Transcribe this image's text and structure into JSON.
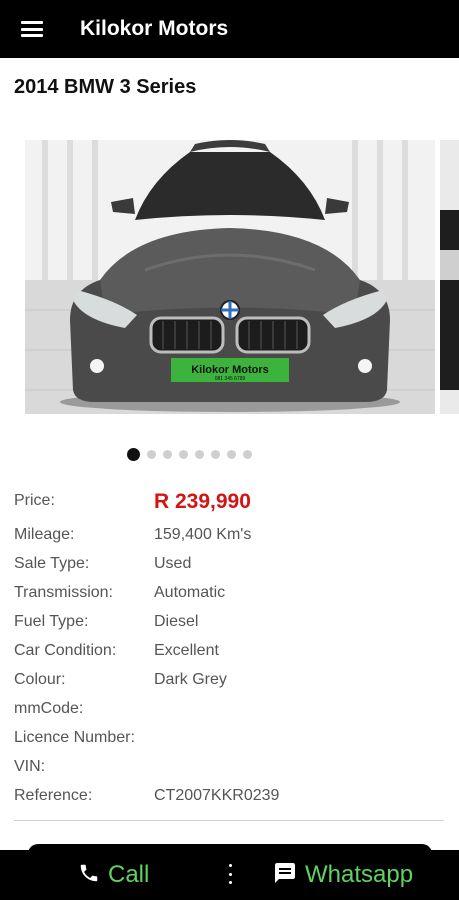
{
  "app": {
    "title": "Kilokor Motors",
    "menu_icon": "hamburger-menu-icon"
  },
  "listing": {
    "title": "2014 BMW 3 Series",
    "photo": {
      "plate_text": "Kilokor Motors",
      "plate_subtext": "081 345 6789"
    },
    "carousel": {
      "total_slides": 8,
      "active_index": 0
    },
    "specs": [
      {
        "label": "Price:",
        "value": "R 239,990"
      },
      {
        "label": "Mileage:",
        "value": "159,400 Km's"
      },
      {
        "label": "Sale Type:",
        "value": "Used"
      },
      {
        "label": "Transmission:",
        "value": "Automatic"
      },
      {
        "label": "Fuel Type:",
        "value": "Diesel"
      },
      {
        "label": "Car Condition:",
        "value": "Excellent"
      },
      {
        "label": "Colour:",
        "value": "Dark Grey"
      },
      {
        "label": "mmCode:",
        "value": ""
      },
      {
        "label": "Licence Number:",
        "value": ""
      },
      {
        "label": "VIN:",
        "value": ""
      },
      {
        "label": "Reference:",
        "value": "CT2007KKR0239"
      }
    ]
  },
  "actions": {
    "call_label": "Call",
    "call_icon": "phone-icon",
    "whatsapp_label": "Whatsapp",
    "whatsapp_icon": "chat-message-icon"
  },
  "colors": {
    "app_bar": "#000000",
    "price": "#d21414",
    "action_text": "#5fd35f"
  }
}
